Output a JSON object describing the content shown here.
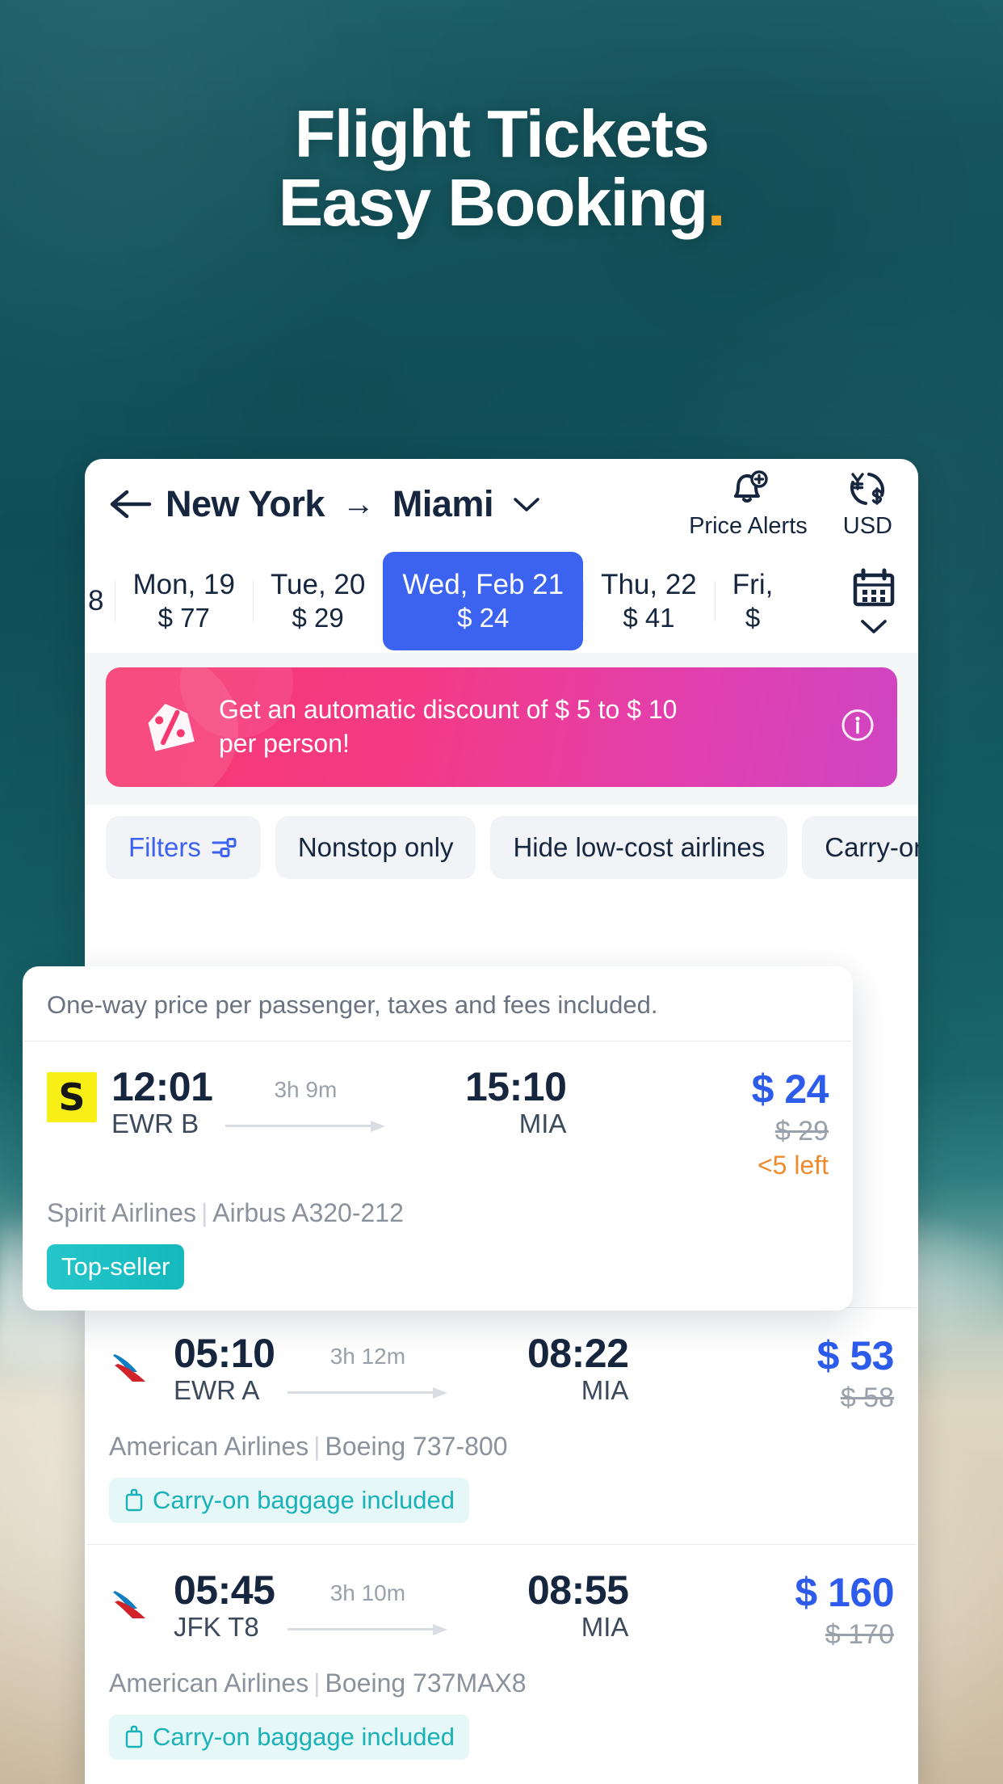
{
  "hero": {
    "line1": "Flight Tickets",
    "line2": "Easy Booking",
    "dot": "."
  },
  "header": {
    "back_icon": "arrow-left-icon",
    "origin": "New York",
    "arrow": "→",
    "destination": "Miami",
    "chevron_icon": "chevron-down-icon",
    "price_alerts_label": "Price Alerts",
    "price_alerts_icon": "bell-plus-icon",
    "currency_label": "USD",
    "currency_icon": "currency-exchange-icon"
  },
  "dates": {
    "items": [
      {
        "day": "8",
        "price": "",
        "selected": false,
        "clipped": true
      },
      {
        "day": "Mon,  19",
        "price": "$ 77",
        "selected": false
      },
      {
        "day": "Tue,  20",
        "price": "$ 29",
        "selected": false
      },
      {
        "day": "Wed, Feb 21",
        "price": "$ 24",
        "selected": true
      },
      {
        "day": "Thu,  22",
        "price": "$ 41",
        "selected": false
      },
      {
        "day": "Fri,",
        "price": "$",
        "selected": false
      }
    ],
    "calendar_icon": "calendar-icon",
    "calendar_chevron_icon": "chevron-down-icon"
  },
  "promo": {
    "text": "Get an automatic discount of $ 5 to $ 10 per person!",
    "tag_icon": "discount-tag-icon",
    "info_icon": "info-circle-icon",
    "dots": [
      true,
      false
    ]
  },
  "filters": {
    "chips": [
      {
        "label": "Filters",
        "icon": "sliders-icon",
        "accent": true
      },
      {
        "label": "Nonstop only",
        "icon": "",
        "accent": false
      },
      {
        "label": "Hide low-cost airlines",
        "icon": "",
        "accent": false
      },
      {
        "label": "Carry-on",
        "icon": "",
        "accent": false
      }
    ]
  },
  "results": {
    "note": "One-way price per passenger, taxes and fees included.",
    "flights": [
      {
        "logo": "spirit-logo",
        "logo_letter": "S",
        "depart_time": "12:01",
        "depart_airport": "EWR B",
        "duration": "3h 9m",
        "arrive_time": "15:10",
        "arrive_airport": "MIA",
        "price": "$ 24",
        "old_price": "$ 29",
        "seats_left": "<5 left",
        "airline": "Spirit Airlines",
        "aircraft": "Airbus A320-212",
        "badge": "Top-seller",
        "badge_type": "top"
      },
      {
        "logo": "american-airlines-logo",
        "logo_letter": "",
        "depart_time": "05:10",
        "depart_airport": "EWR A",
        "duration": "3h 12m",
        "arrive_time": "08:22",
        "arrive_airport": "MIA",
        "price": "$ 53",
        "old_price": "$ 58",
        "seats_left": "",
        "airline": "American Airlines",
        "aircraft": "Boeing 737-800",
        "badge": "Carry-on baggage included",
        "badge_type": "carry"
      },
      {
        "logo": "american-airlines-logo",
        "logo_letter": "",
        "depart_time": "05:45",
        "depart_airport": "JFK T8",
        "duration": "3h 10m",
        "arrive_time": "08:55",
        "arrive_airport": "MIA",
        "price": "$ 160",
        "old_price": "$ 170",
        "seats_left": "",
        "airline": "American Airlines",
        "aircraft": "Boeing 737MAX8",
        "badge": "Carry-on baggage included",
        "badge_type": "carry"
      }
    ]
  },
  "colors": {
    "accent_blue": "#3b63f0",
    "navy": "#16263f",
    "orange": "#ef8b2c",
    "teal": "#19b2b8",
    "promo_pink": "#f6386f",
    "promo_magenta": "#cf45c2",
    "spirit_yellow": "#f7ef16",
    "hero_dot": "#f5a623"
  }
}
